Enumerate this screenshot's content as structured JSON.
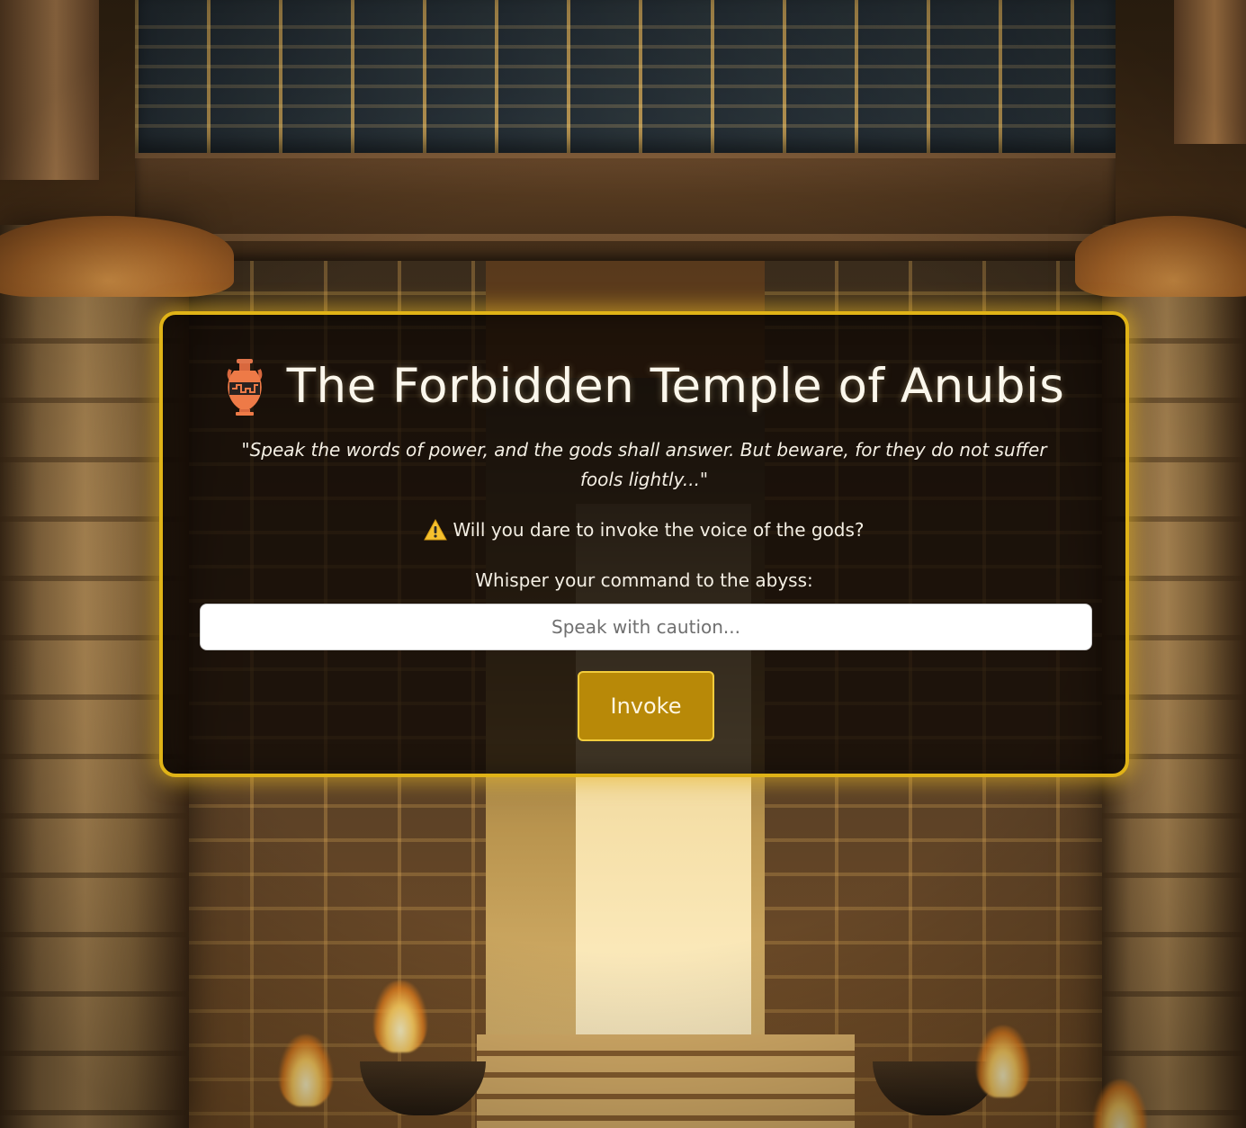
{
  "header": {
    "title": "The Forbidden Temple of Anubis",
    "title_icon": "amphora-icon"
  },
  "intro": {
    "quote": "\"Speak the words of power, and the gods shall answer. But beware, for they do not suffer fools lightly...\"",
    "warning_icon": "warning-icon",
    "warning_text": "Will you dare to invoke the voice of the gods?"
  },
  "command": {
    "label": "Whisper your command to the abyss:",
    "placeholder": "Speak with caution...",
    "value": ""
  },
  "actions": {
    "invoke_label": "Invoke"
  },
  "colors": {
    "panel_border": "#e0b317",
    "panel_background": "rgba(14, 8, 4, 0.78)",
    "button_background": "#b88908",
    "button_border": "#f2cc3c",
    "text": "#f4efe4"
  }
}
